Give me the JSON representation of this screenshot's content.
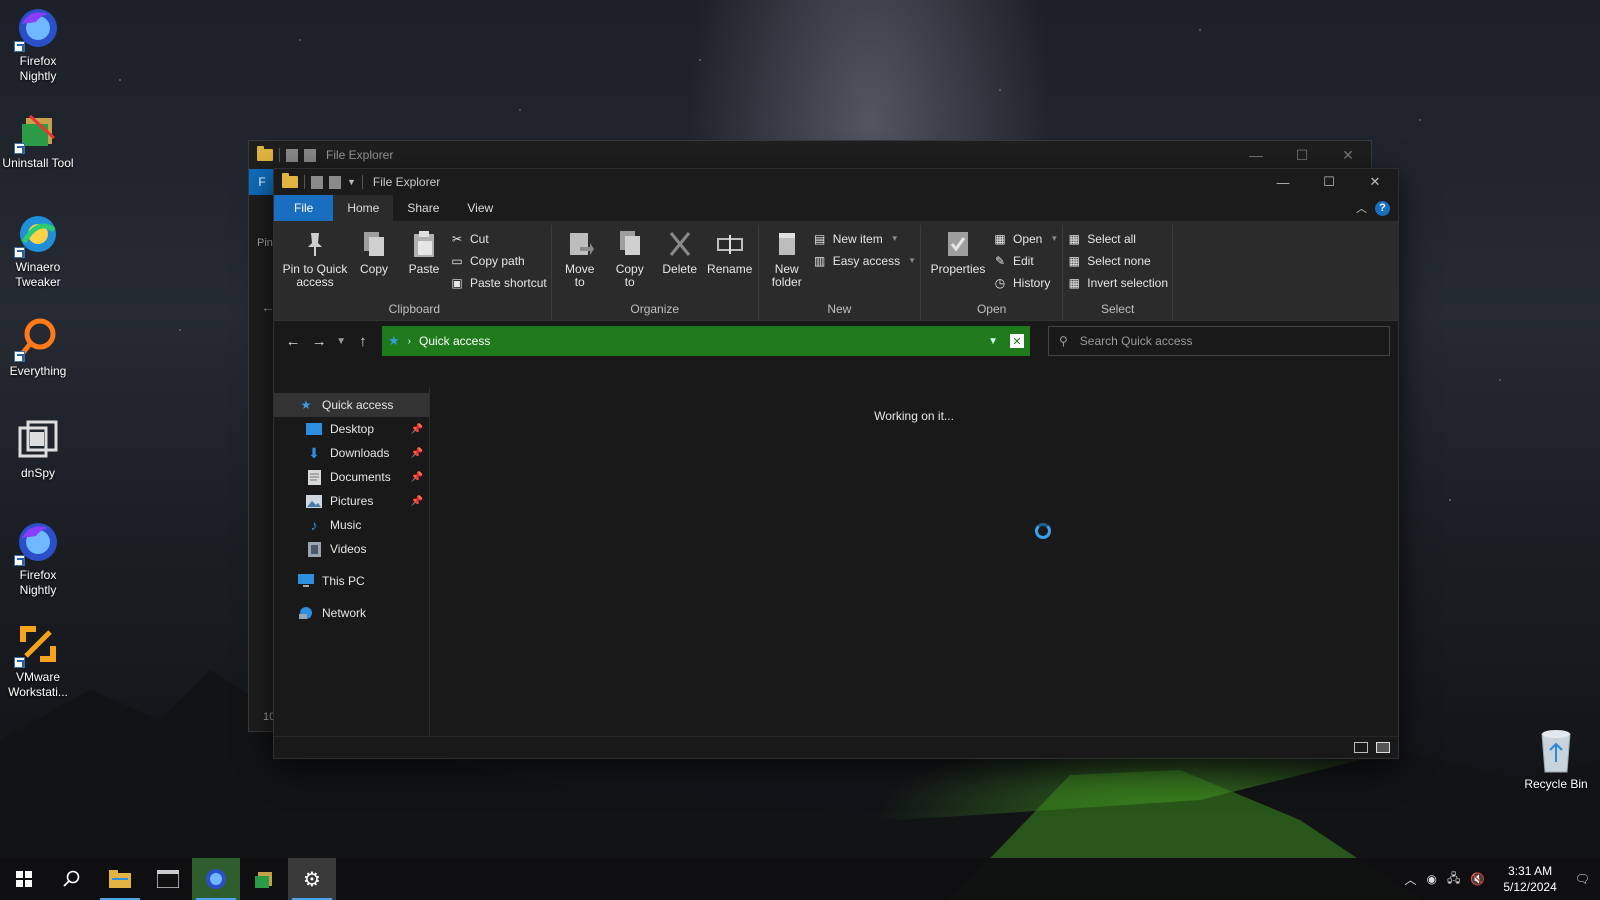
{
  "desktop": {
    "icons": [
      {
        "label_line1": "Firefox",
        "label_line2": "Nightly",
        "icon": "firefox-nightly-icon"
      },
      {
        "label_line1": "Uninstall Tool",
        "label_line2": "",
        "icon": "uninstall-tool-icon"
      },
      {
        "label_line1": "Winaero",
        "label_line2": "Tweaker",
        "icon": "winaero-tweaker-icon"
      },
      {
        "label_line1": "Everything",
        "label_line2": "",
        "icon": "everything-icon"
      },
      {
        "label_line1": "dnSpy",
        "label_line2": "",
        "icon": "dnspy-icon"
      },
      {
        "label_line1": "Firefox",
        "label_line2": "Nightly",
        "icon": "firefox-nightly-icon"
      },
      {
        "label_line1": "VMware",
        "label_line2": "Workstati...",
        "icon": "vmware-icon"
      }
    ],
    "recycle_bin_label": "Recycle Bin"
  },
  "back_window": {
    "title": "File Explorer",
    "file_tab_partial": "F",
    "pin_partial": "Pin",
    "count_partial": "10"
  },
  "window": {
    "title": "File Explorer",
    "tabs": [
      {
        "label": "File"
      },
      {
        "label": "Home"
      },
      {
        "label": "Share"
      },
      {
        "label": "View"
      }
    ],
    "ribbon": {
      "clipboard": {
        "label": "Clipboard",
        "pin": "Pin to Quick access",
        "pin_l1": "Pin to Quick",
        "pin_l2": "access",
        "copy": "Copy",
        "paste": "Paste",
        "cut": "Cut",
        "copy_path": "Copy path",
        "paste_shortcut": "Paste shortcut"
      },
      "organize": {
        "label": "Organize",
        "move_l1": "Move",
        "move_l2": "to",
        "copy_l1": "Copy",
        "copy_l2": "to",
        "delete": "Delete",
        "rename": "Rename"
      },
      "new": {
        "label": "New",
        "folder_l1": "New",
        "folder_l2": "folder",
        "new_item": "New item",
        "easy_access": "Easy access"
      },
      "open": {
        "label": "Open",
        "properties": "Properties",
        "open": "Open",
        "edit": "Edit",
        "history": "History"
      },
      "select": {
        "label": "Select",
        "select_all": "Select all",
        "select_none": "Select none",
        "invert": "Invert selection"
      }
    },
    "address": {
      "path": "Quick access",
      "search_placeholder": "Search Quick access"
    },
    "nav": {
      "quick_access": "Quick access",
      "items": [
        {
          "label": "Desktop",
          "pinned": true
        },
        {
          "label": "Downloads",
          "pinned": true
        },
        {
          "label": "Documents",
          "pinned": true
        },
        {
          "label": "Pictures",
          "pinned": true
        },
        {
          "label": "Music",
          "pinned": false
        },
        {
          "label": "Videos",
          "pinned": false
        }
      ],
      "this_pc": "This PC",
      "network": "Network"
    },
    "main": {
      "status_text": "Working on it..."
    }
  },
  "taskbar": {
    "time": "3:31 AM",
    "date": "5/12/2024"
  },
  "colors": {
    "accent": "#1a6ebf",
    "address_bar": "#1e7a1a",
    "window_bg": "#191919",
    "ribbon_bg": "#2b2b2b"
  }
}
